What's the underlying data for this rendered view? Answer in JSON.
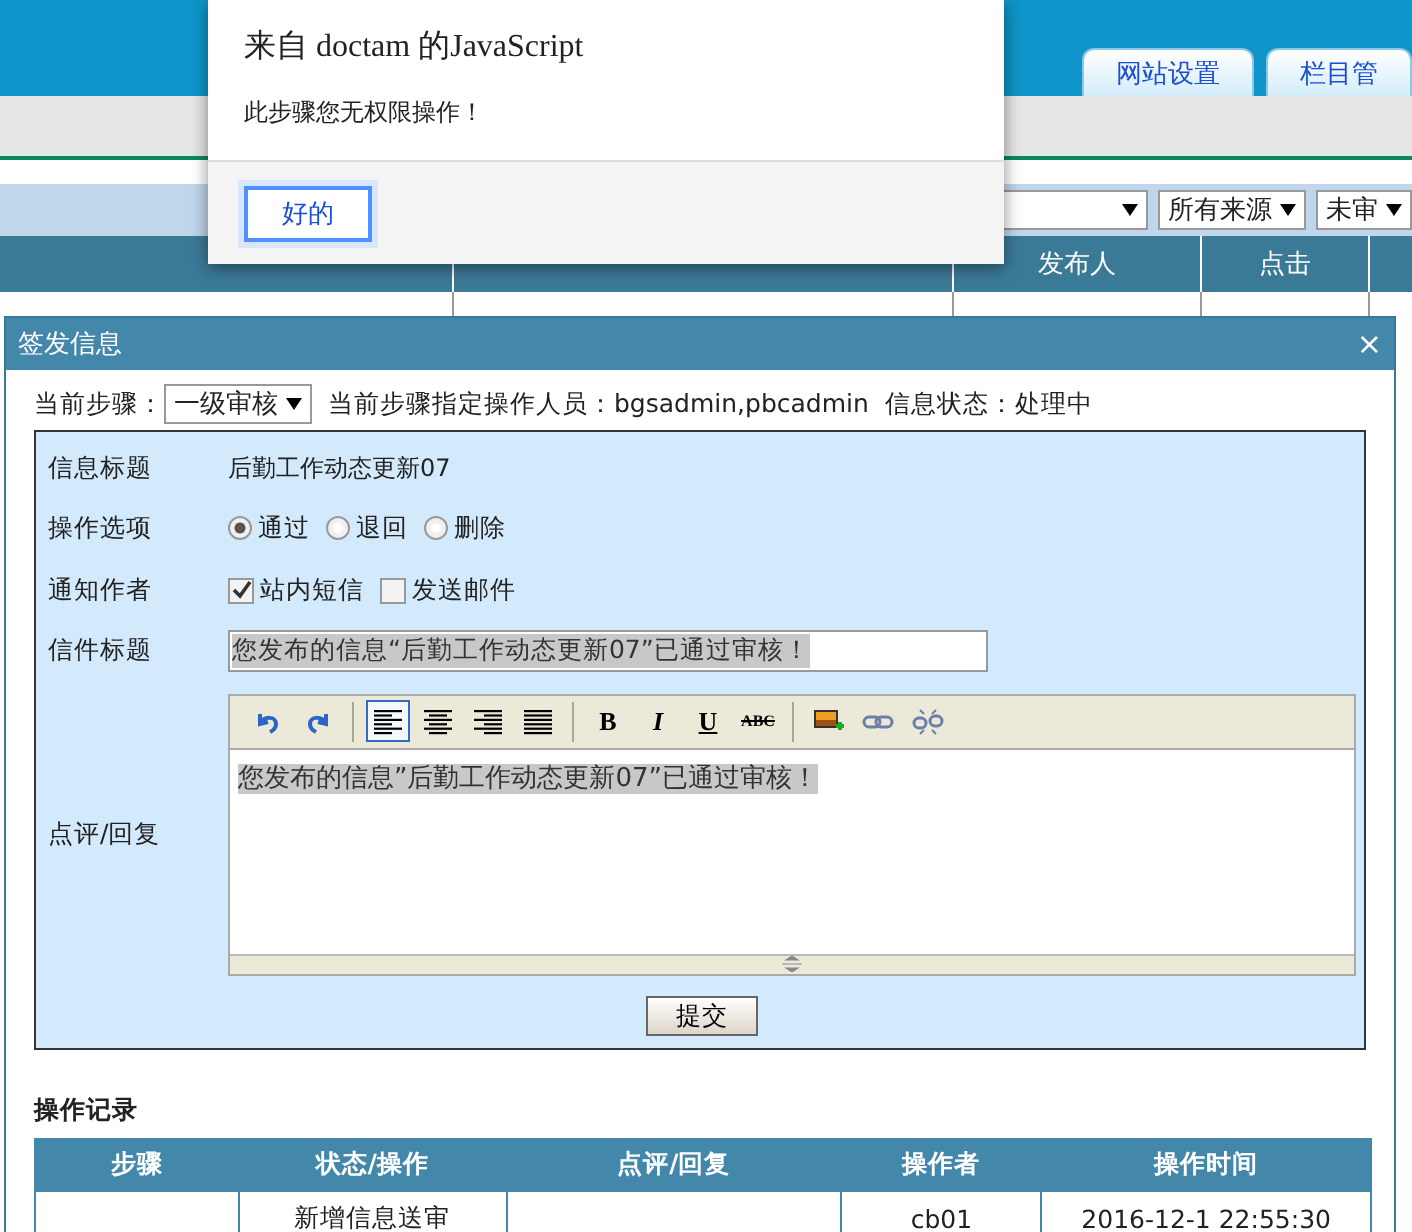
{
  "header": {
    "tabs": [
      {
        "label": "网站设置",
        "selected": false
      },
      {
        "label": "栏目管",
        "selected": false
      }
    ]
  },
  "filter": {
    "selects": [
      "所有来源",
      "未审"
    ]
  },
  "list": {
    "columns": [
      "发布人",
      "点击"
    ]
  },
  "alert": {
    "title": "来自 doctam 的JavaScript",
    "message": "此步骤您无权限操作！",
    "button": "好的"
  },
  "dialog": {
    "title": "签发信息",
    "close": "×",
    "step": {
      "label": "当前步骤：",
      "value": "一级审核",
      "operators": "当前步骤指定操作人员：bgsadmin,pbcadmin",
      "status": "信息状态：处理中"
    },
    "fields": [
      {
        "kind": "text",
        "label": "信息标题",
        "value": "后勤工作动态更新07"
      },
      {
        "kind": "radio",
        "label": "操作选项",
        "options": [
          {
            "label": "通过",
            "selected": true
          },
          {
            "label": "退回",
            "selected": false
          },
          {
            "label": "删除",
            "selected": false
          }
        ]
      },
      {
        "kind": "checkbox",
        "label": "通知作者",
        "options": [
          {
            "label": "站内短信",
            "checked": true
          },
          {
            "label": "发送邮件",
            "checked": false
          }
        ]
      },
      {
        "kind": "input",
        "label": "信件标题",
        "value": "您发布的信息“后勤工作动态更新07”已通过审核！"
      },
      {
        "kind": "editor",
        "label": "点评/回复",
        "value": "您发布的信息”后勤工作动态更新07”已通过审核！",
        "toolbar": [
          {
            "kind": "undo",
            "selected": false
          },
          {
            "kind": "redo",
            "selected": false
          },
          {
            "kind": "sep"
          },
          {
            "kind": "align-left",
            "selected": true
          },
          {
            "kind": "align-center",
            "selected": false
          },
          {
            "kind": "align-right",
            "selected": false
          },
          {
            "kind": "justify",
            "selected": false
          },
          {
            "kind": "sep"
          },
          {
            "kind": "bold",
            "label": "B",
            "selected": false
          },
          {
            "kind": "italic",
            "label": "I",
            "selected": false
          },
          {
            "kind": "underline",
            "label": "U",
            "selected": false
          },
          {
            "kind": "strike",
            "label": "ABC",
            "selected": false
          },
          {
            "kind": "sep"
          },
          {
            "kind": "image",
            "selected": false
          },
          {
            "kind": "link",
            "selected": false
          },
          {
            "kind": "unlink",
            "selected": false
          }
        ]
      }
    ],
    "submit": "提交",
    "log": {
      "title": "操作记录",
      "columns": [
        "步骤",
        "状态/操作",
        "点评/回复",
        "操作者",
        "操作时间"
      ],
      "rows": [
        [
          null,
          "新增信息送审",
          null,
          "cb01",
          "2016-12-1 22:55:30"
        ]
      ]
    }
  }
}
